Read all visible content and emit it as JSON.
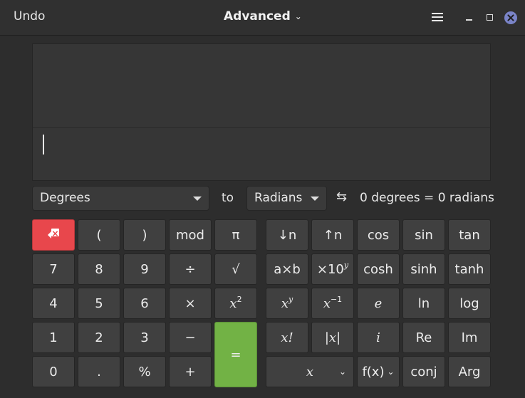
{
  "header": {
    "undo_label": "Undo",
    "title": "Advanced",
    "title_chevron": "⌄"
  },
  "display": {
    "history": "",
    "entry": ""
  },
  "conversion": {
    "from_unit": "Degrees",
    "to_label": "to",
    "to_unit": "Radians",
    "swap_symbol": "⇆",
    "result": "0 degrees = 0 radians"
  },
  "keypad": {
    "basic": {
      "open_paren": "(",
      "close_paren": ")",
      "mod": "mod",
      "pi": "π",
      "seven": "7",
      "eight": "8",
      "nine": "9",
      "divide": "÷",
      "sqrt": "√",
      "four": "4",
      "five": "5",
      "six": "6",
      "multiply": "×",
      "square_base": "x",
      "square_exp": "2",
      "one": "1",
      "two": "2",
      "three": "3",
      "minus": "−",
      "equals": "=",
      "zero": "0",
      "decimal": ".",
      "percent": "%",
      "plus": "+"
    },
    "advanced": {
      "subscript": "↓n",
      "superscript": "↑n",
      "cos": "cos",
      "sin": "sin",
      "tan": "tan",
      "sci_notation": "a×b",
      "ten_power_base": "×10",
      "ten_power_exp": "y",
      "cosh": "cosh",
      "sinh": "sinh",
      "tanh": "tanh",
      "power_base": "x",
      "power_exp": "y",
      "inverse_base": "x",
      "inverse_exp": "−1",
      "e": "e",
      "ln": "ln",
      "log": "log",
      "factorial": "x!",
      "abs": "|x|",
      "imaginary": "i",
      "re": "Re",
      "im": "Im",
      "variable": "x",
      "function": "f(x)",
      "conj": "conj",
      "arg": "Arg"
    }
  },
  "colors": {
    "backspace": "#e8474c",
    "equals": "#72b245",
    "close": "#7a84c8"
  }
}
